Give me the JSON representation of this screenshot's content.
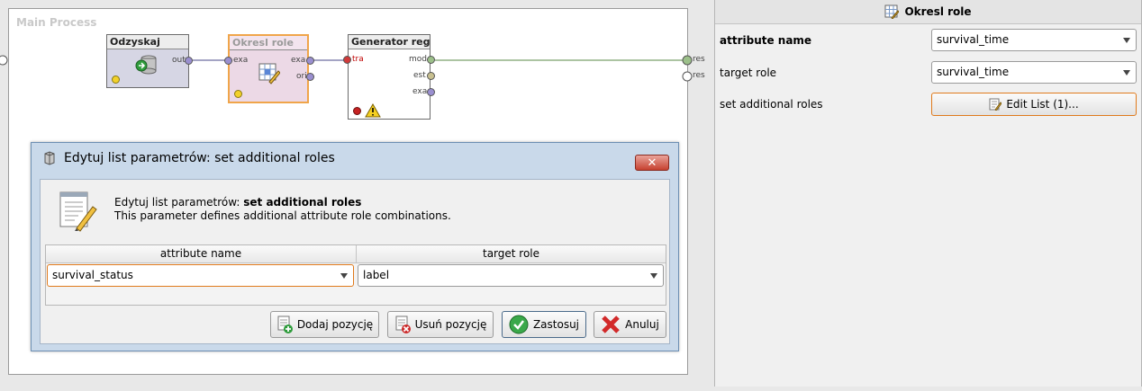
{
  "process": {
    "title": "Main Process",
    "operators": [
      {
        "name": "Odzyskaj",
        "out_port": "out"
      },
      {
        "name": "Okresl role",
        "in_port": "exa",
        "out_ports": [
          "exa",
          "ori"
        ]
      },
      {
        "name": "Generator reg...",
        "in_port": "tra",
        "out_ports": [
          "mod",
          "est",
          "exa"
        ]
      }
    ],
    "result_ports": [
      "res",
      "res"
    ]
  },
  "params_panel": {
    "title": "Okresl role",
    "rows": [
      {
        "label": "attribute name",
        "value": "survival_time"
      },
      {
        "label": "target role",
        "value": "survival_time"
      },
      {
        "label": "set additional roles",
        "button": "Edit List (1)..."
      }
    ]
  },
  "dialog": {
    "title": "Edytuj list parametrów: set additional roles",
    "close_label": "✕",
    "desc_prefix": "Edytuj list parametrów: ",
    "desc_bold": "set additional roles",
    "desc_line2": "This parameter defines additional attribute role combinations.",
    "columns": [
      "attribute name",
      "target role"
    ],
    "row": {
      "attribute": "survival_status",
      "role": "label"
    },
    "buttons": {
      "add": "Dodaj pozycję",
      "remove": "Usuń pozycję",
      "apply": "Zastosuj",
      "cancel": "Anuluj"
    }
  }
}
